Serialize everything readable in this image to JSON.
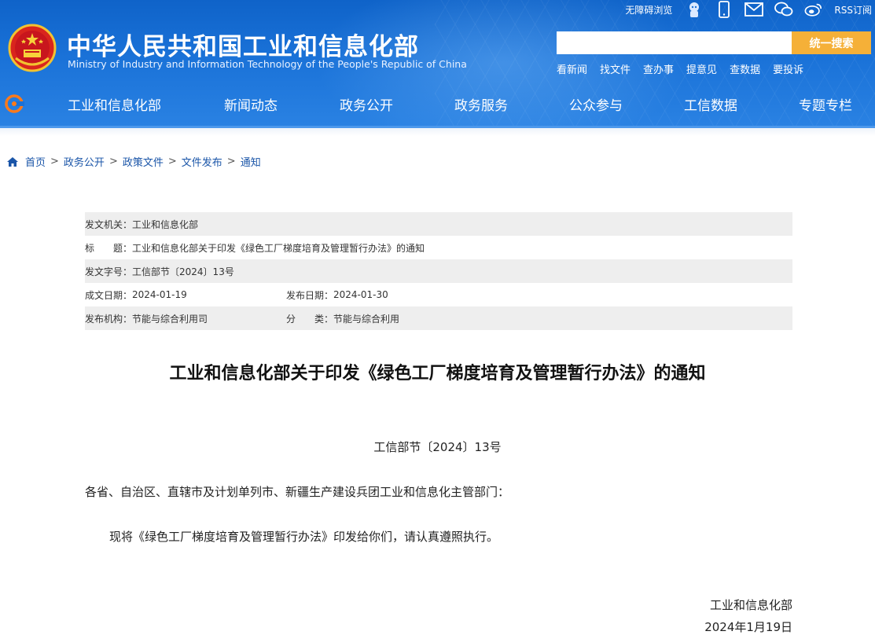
{
  "header": {
    "title": "中华人民共和国工业和信息化部",
    "subtitle": "Ministry of Industry and Information Technology of the People's Republic of China",
    "accessible_label": "无障碍浏览",
    "rss_label": "RSS订阅",
    "search_placeholder": "",
    "search_button": "统一搜索",
    "quick_links": [
      "看新闻",
      "找文件",
      "查办事",
      "提意见",
      "查数据",
      "要投诉"
    ]
  },
  "nav": [
    "工业和信息化部",
    "新闻动态",
    "政务公开",
    "政务服务",
    "公众参与",
    "工信数据",
    "专题专栏"
  ],
  "breadcrumb": [
    "首页",
    "政务公开",
    "政策文件",
    "文件发布",
    "通知"
  ],
  "info": {
    "issuer_label": "发文机关：",
    "issuer": "工业和信息化部",
    "title_label": "标　　题：",
    "title": "工业和信息化部关于印发《绿色工厂梯度培育及管理暂行办法》的通知",
    "doc_no_label": "发文字号：",
    "doc_no": "工信部节〔2024〕13号",
    "written_label": "成文日期：",
    "written_date": "2024-01-19",
    "published_label": "发布日期：",
    "published_date": "2024-01-30",
    "org_label": "发布机构：",
    "org": "节能与综合利用司",
    "category_label": "分　　类：",
    "category": "节能与综合利用"
  },
  "article": {
    "title": "工业和信息化部关于印发《绿色工厂梯度培育及管理暂行办法》的通知",
    "doc_number": "工信部节〔2024〕13号",
    "addressee": "各省、自治区、直辖市及计划单列市、新疆生产建设兵团工业和信息化主管部门：",
    "body": "现将《绿色工厂梯度培育及管理暂行办法》印发给你们，请认真遵照执行。",
    "sign_org": "工业和信息化部",
    "sign_date": "2024年1月19日"
  },
  "colors": {
    "header_blue": "#1a72d8",
    "search_button": "#f5b038",
    "link_blue": "#1a55a8"
  }
}
